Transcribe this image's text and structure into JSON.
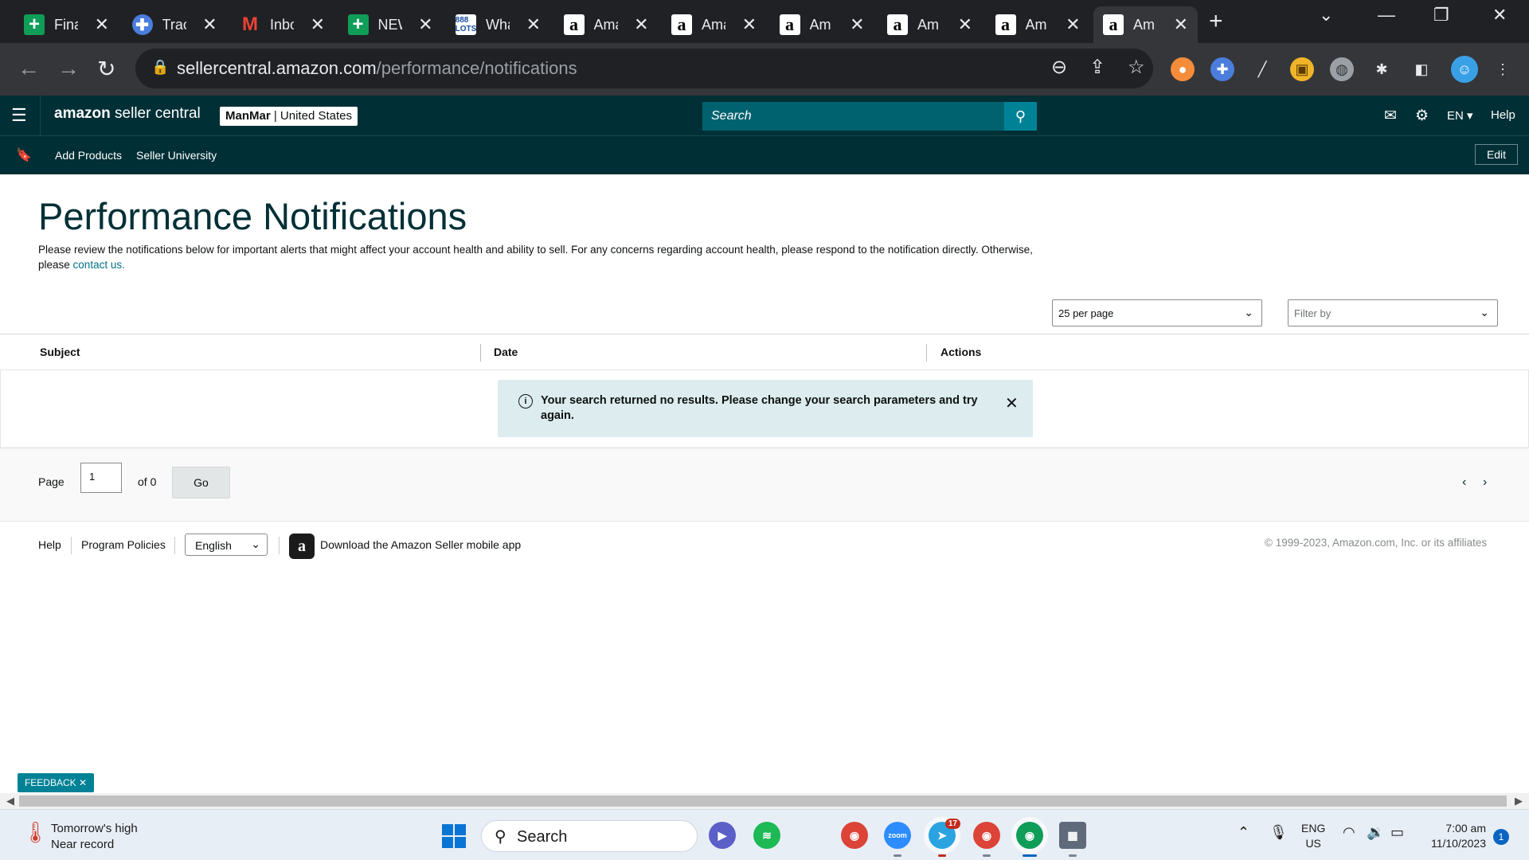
{
  "browser": {
    "tabs": [
      {
        "title": "Fina",
        "icon": "google-sheets-icon",
        "glyph": "+"
      },
      {
        "title": "Trac",
        "icon": "tracker-icon",
        "glyph": "✚"
      },
      {
        "title": "Inbo",
        "icon": "gmail-icon",
        "glyph": "M"
      },
      {
        "title": "NEW",
        "icon": "google-sheets-icon",
        "glyph": "+"
      },
      {
        "title": "Wha",
        "icon": "888-lots-icon",
        "glyph": "888 LOTS"
      },
      {
        "title": "Ama",
        "icon": "amazon-icon",
        "glyph": "a"
      },
      {
        "title": "Ama",
        "icon": "amazon-icon",
        "glyph": "a"
      },
      {
        "title": "Am",
        "icon": "amazon-icon",
        "glyph": "a"
      },
      {
        "title": "Am",
        "icon": "amazon-icon",
        "glyph": "a"
      },
      {
        "title": "Am",
        "icon": "amazon-icon",
        "glyph": "a"
      },
      {
        "title": "Am",
        "icon": "amazon-icon",
        "glyph": "a"
      }
    ],
    "url_host": "sellercentral.amazon.com",
    "url_path": "/performance/notifications"
  },
  "header": {
    "logo_amazon": "amazon",
    "logo_rest": " seller central",
    "account_name": "ManMar",
    "account_sep": " | ",
    "account_region": "United States",
    "search_placeholder": "Search",
    "language": "EN ▾",
    "help": "Help"
  },
  "bookmarks": {
    "items": [
      "Add Products",
      "Seller University"
    ],
    "edit": "Edit"
  },
  "page": {
    "title": "Performance Notifications",
    "description": "Please review the notifications below for important alerts that might affect your account health and ability to sell. For any concerns regarding account health, please respond to the notification directly. Otherwise, please ",
    "contact_link": "contact us.",
    "per_page": "25 per page",
    "filter_placeholder": "Filter by",
    "columns": [
      "Subject",
      "Date",
      "Actions"
    ],
    "alert_text": "Your search returned no results. Please change your search parameters and try again.",
    "pager": {
      "label": "Page",
      "value": "1",
      "of": "of 0",
      "go": "Go"
    }
  },
  "footer": {
    "help": "Help",
    "policies": "Program Policies",
    "language": "English",
    "app_link": "Download the Amazon Seller mobile app",
    "copyright": "© 1999-2023, Amazon.com, Inc. or its affiliates"
  },
  "feedback": "FEEDBACK ✕",
  "taskbar": {
    "weather_line1": "Tomorrow's high",
    "weather_line2": "Near record",
    "search": "Search",
    "telegram_badge": "17",
    "lang_line1": "ENG",
    "lang_line2": "US",
    "time": "7:00 am",
    "date": "11/10/2023",
    "notifications": "1"
  },
  "colors": {
    "seller_central_dark": "#002f36",
    "search_bg": "#00626e",
    "link": "#007185",
    "alert_bg": "#dcecef",
    "feedback_bg": "#008296"
  }
}
